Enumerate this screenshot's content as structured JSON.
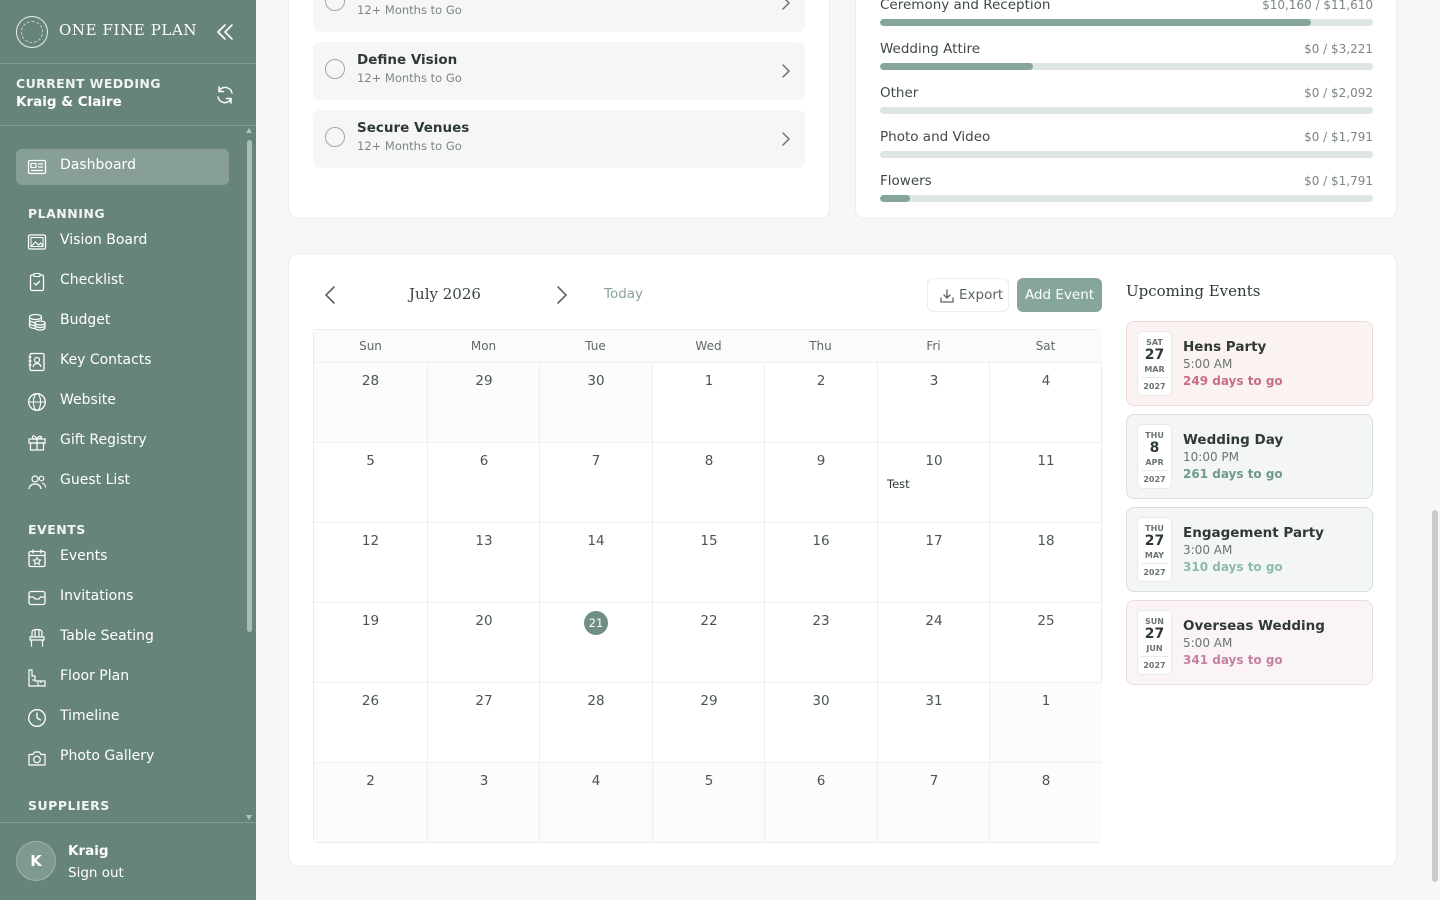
{
  "app": {
    "name": "ONE FINE PLAN"
  },
  "wedding": {
    "label": "CURRENT WEDDING",
    "name": "Kraig & Claire"
  },
  "nav": {
    "dashboard": "Dashboard",
    "planning_title": "PLANNING",
    "planning": [
      "Vision Board",
      "Checklist",
      "Budget",
      "Key Contacts",
      "Website",
      "Gift Registry",
      "Guest List"
    ],
    "events_title": "EVENTS",
    "events": [
      "Events",
      "Invitations",
      "Table Seating",
      "Floor Plan",
      "Timeline",
      "Photo Gallery"
    ],
    "suppliers_title": "SUPPLIERS"
  },
  "user": {
    "initial": "K",
    "name": "Kraig",
    "signout": "Sign out"
  },
  "checklist": {
    "tasks": [
      {
        "title": "",
        "subtitle": "12+ Months to Go"
      },
      {
        "title": "Define Vision",
        "subtitle": "12+ Months to Go"
      },
      {
        "title": "Secure Venues",
        "subtitle": "12+ Months to Go"
      }
    ]
  },
  "budget": {
    "rows": [
      {
        "label": "Ceremony and Reception",
        "value": "$10,160 / $11,610",
        "progress": 0.875
      },
      {
        "label": "Wedding Attire",
        "value": "$0 / $3,221",
        "progress": 0.31
      },
      {
        "label": "Other",
        "value": "$0 / $2,092",
        "progress": 0
      },
      {
        "label": "Photo and Video",
        "value": "$0 / $1,791",
        "progress": 0
      },
      {
        "label": "Flowers",
        "value": "$0 / $1,791",
        "progress": 0.06
      }
    ]
  },
  "calendar": {
    "month_label": "July 2026",
    "today_label": "Today",
    "export_label": "Export",
    "add_event_label": "Add Event",
    "weekdays": [
      "Sun",
      "Mon",
      "Tue",
      "Wed",
      "Thu",
      "Fri",
      "Sat"
    ],
    "weeks": [
      [
        {
          "d": "28",
          "o": true
        },
        {
          "d": "29",
          "o": true
        },
        {
          "d": "30",
          "o": true
        },
        {
          "d": "1"
        },
        {
          "d": "2"
        },
        {
          "d": "3"
        },
        {
          "d": "4"
        }
      ],
      [
        {
          "d": "5"
        },
        {
          "d": "6"
        },
        {
          "d": "7"
        },
        {
          "d": "8"
        },
        {
          "d": "9"
        },
        {
          "d": "10",
          "ev": "Test"
        },
        {
          "d": "11"
        }
      ],
      [
        {
          "d": "12"
        },
        {
          "d": "13"
        },
        {
          "d": "14"
        },
        {
          "d": "15"
        },
        {
          "d": "16"
        },
        {
          "d": "17"
        },
        {
          "d": "18"
        }
      ],
      [
        {
          "d": "19"
        },
        {
          "d": "20"
        },
        {
          "d": "21",
          "t": true
        },
        {
          "d": "22"
        },
        {
          "d": "23"
        },
        {
          "d": "24"
        },
        {
          "d": "25"
        }
      ],
      [
        {
          "d": "26"
        },
        {
          "d": "27"
        },
        {
          "d": "28"
        },
        {
          "d": "29"
        },
        {
          "d": "30"
        },
        {
          "d": "31"
        },
        {
          "d": "1",
          "o": true
        }
      ],
      [
        {
          "d": "2",
          "o": true
        },
        {
          "d": "3",
          "o": true
        },
        {
          "d": "4",
          "o": true
        },
        {
          "d": "5",
          "o": true
        },
        {
          "d": "6",
          "o": true
        },
        {
          "d": "7",
          "o": true
        },
        {
          "d": "8",
          "o": true
        }
      ]
    ]
  },
  "upcoming": {
    "title": "Upcoming Events",
    "events": [
      {
        "dow": "SAT",
        "day": "27",
        "month": "MAR",
        "year": "2027",
        "name": "Hens Party",
        "time": "5:00 AM",
        "left": "249 days to go",
        "tone": "pink",
        "color": "#c76f82"
      },
      {
        "dow": "THU",
        "day": "8",
        "month": "APR",
        "year": "2027",
        "name": "Wedding Day",
        "time": "10:00 PM",
        "left": "261 days to go",
        "tone": "green",
        "color": "#6f9a88"
      },
      {
        "dow": "THU",
        "day": "27",
        "month": "MAY",
        "year": "2027",
        "name": "Engagement Party",
        "time": "3:00 AM",
        "left": "310 days to go",
        "tone": "green",
        "color": "#8dbbaa"
      },
      {
        "dow": "SUN",
        "day": "27",
        "month": "JUN",
        "year": "2027",
        "name": "Overseas Wedding",
        "time": "5:00 AM",
        "left": "341 days to go",
        "tone": "rose",
        "color": "#c681a2"
      }
    ]
  },
  "colors": {
    "sidebar": "#67847a",
    "accent": "#86a699",
    "today": "#6f8f83"
  }
}
